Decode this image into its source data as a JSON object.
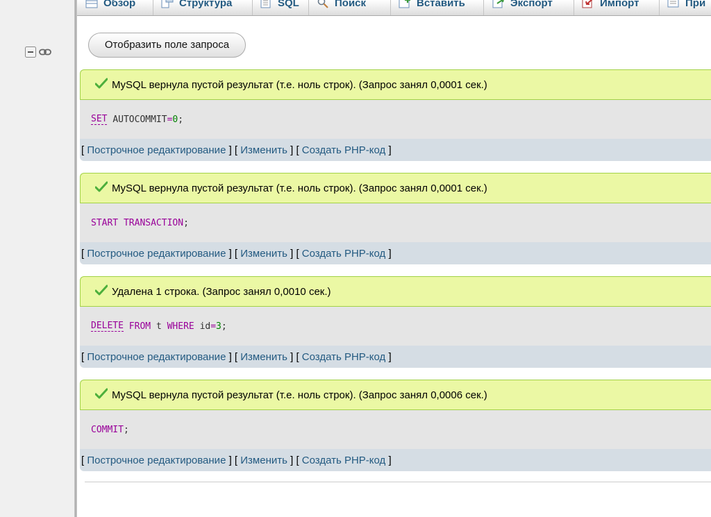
{
  "tabs": [
    {
      "label": "Обзор",
      "icon": "browse-icon"
    },
    {
      "label": "Структура",
      "icon": "structure-icon"
    },
    {
      "label": "SQL",
      "icon": "sql-icon"
    },
    {
      "label": "Поиск",
      "icon": "search-icon"
    },
    {
      "label": "Вставить",
      "icon": "insert-icon"
    },
    {
      "label": "Экспорт",
      "icon": "export-icon"
    },
    {
      "label": "Импорт",
      "icon": "import-icon"
    },
    {
      "label": "При",
      "icon": "privileges-icon"
    }
  ],
  "show_query_label": "Отобразить поле запроса",
  "results": [
    {
      "message": "MySQL вернула пустой результат (т.е. ноль строк). (Запрос занял 0,0001 сек.)",
      "sql": {
        "kw1": "SET",
        "ident": "AUTOCOMMIT",
        "op": "=",
        "num": "0",
        "end": ";"
      }
    },
    {
      "message": "MySQL вернула пустой результат (т.е. ноль строк). (Запрос занял 0,0001 сек.)",
      "sql": {
        "kw1": "START",
        "kw2": "TRANSACTION",
        "end": ";"
      }
    },
    {
      "message": "Удалена 1 строка. (Запрос занял 0,0010 сек.)",
      "sql": {
        "kw1": "DELETE",
        "kw2": "FROM",
        "table": "t",
        "kw3": "WHERE",
        "col": "id",
        "op": "=",
        "num": "3",
        "end": ";"
      }
    },
    {
      "message": "MySQL вернула пустой результат (т.е. ноль строк). (Запрос занял 0,0006 сек.)",
      "sql": {
        "kw1": "COMMIT",
        "end": ";"
      }
    }
  ],
  "links": {
    "inline_edit": "Построчное редактирование",
    "edit": "Изменить",
    "create_php": "Создать PHP-код",
    "open": "[",
    "sep": "] [",
    "close": "]"
  },
  "colors": {
    "success_bg": "#ebf8a4",
    "success_border": "#a2d246",
    "sql_bg": "#e5e5e5",
    "tools_bg": "#d5dde4",
    "link": "#235a81",
    "keyword": "#990099",
    "number": "#008000"
  }
}
